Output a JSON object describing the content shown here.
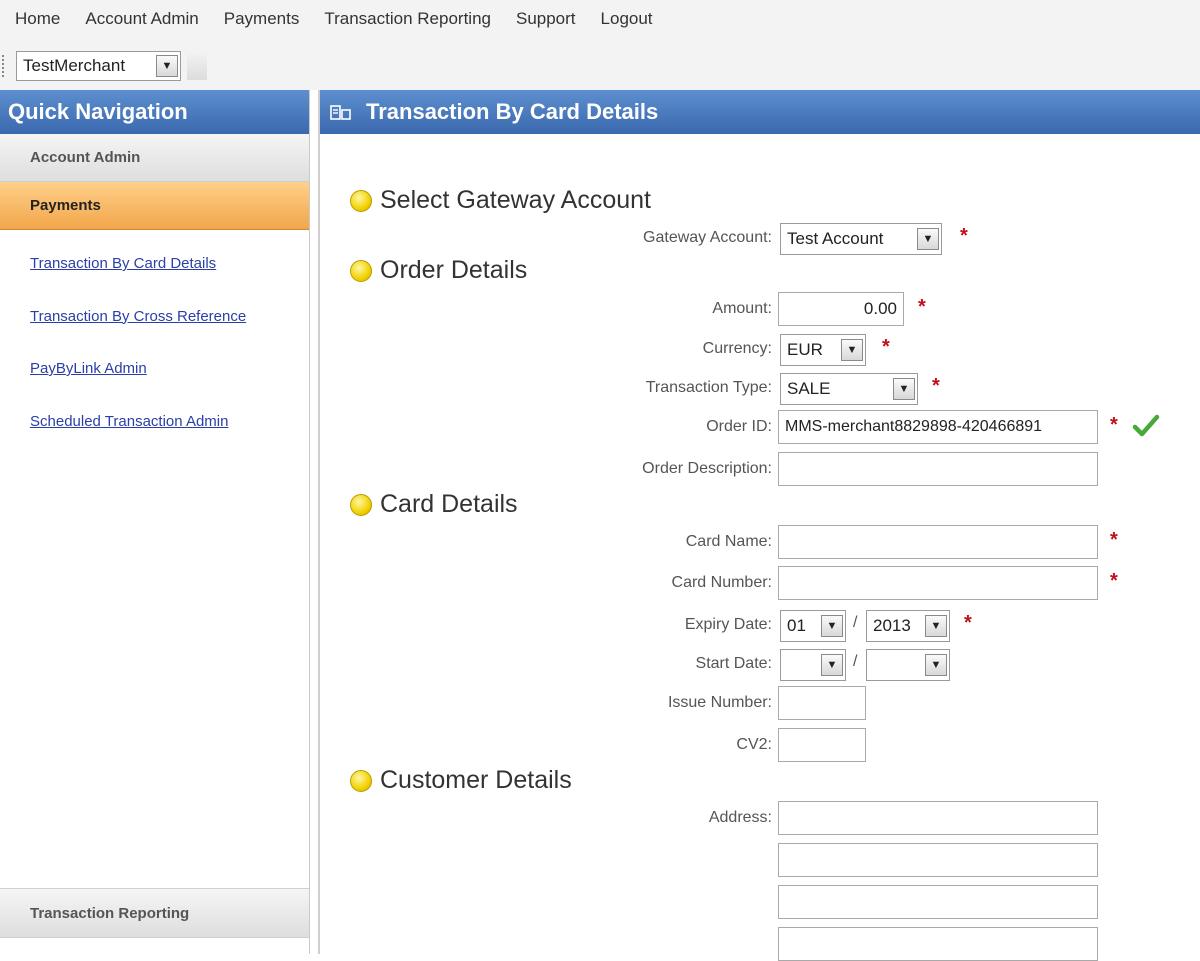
{
  "topmenu": [
    "Home",
    "Account Admin",
    "Payments",
    "Transaction Reporting",
    "Support",
    "Logout"
  ],
  "merchant": {
    "selected": "TestMerchant"
  },
  "sidebar": {
    "title": "Quick Navigation",
    "sections": {
      "account_admin": "Account Admin",
      "payments": "Payments",
      "transaction_reporting": "Transaction Reporting"
    },
    "links": [
      "Transaction By Card Details",
      "Transaction By Cross Reference",
      "PayByLink Admin",
      "Scheduled Transaction Admin"
    ]
  },
  "main": {
    "title": "Transaction By Card Details",
    "sections": {
      "gateway": "Select Gateway Account",
      "order": "Order Details",
      "card": "Card Details",
      "customer": "Customer Details"
    },
    "fields": {
      "gateway_account": {
        "label": "Gateway Account:",
        "value": "Test Account"
      },
      "amount": {
        "label": "Amount:",
        "value": "0.00"
      },
      "currency": {
        "label": "Currency:",
        "value": "EUR"
      },
      "transaction_type": {
        "label": "Transaction Type:",
        "value": "SALE"
      },
      "order_id": {
        "label": "Order ID:",
        "value": "MMS-merchant8829898-420466891"
      },
      "order_description": {
        "label": "Order Description:",
        "value": ""
      },
      "card_name": {
        "label": "Card Name:",
        "value": ""
      },
      "card_number": {
        "label": "Card Number:",
        "value": ""
      },
      "expiry_date": {
        "label": "Expiry Date:",
        "month": "01",
        "year": "2013",
        "separator": "/"
      },
      "start_date": {
        "label": "Start Date:",
        "month": "",
        "year": "",
        "separator": "/"
      },
      "issue_number": {
        "label": "Issue Number:",
        "value": ""
      },
      "cv2": {
        "label": "CV2:",
        "value": ""
      },
      "address": {
        "label": "Address:",
        "lines": [
          "",
          "",
          "",
          ""
        ]
      }
    },
    "required_marker": "*"
  },
  "colors": {
    "header_blue": "#3a69ad",
    "active_orange": "#f2a64a",
    "required_red": "#c0101b",
    "check_green": "#4aa83a",
    "link_blue": "#2a3fa8"
  },
  "icons": {
    "dropdown": "dropdown-arrow-icon",
    "bullet": "yellow-bullet-icon",
    "valid": "checkmark-icon",
    "page": "page-header-icon"
  }
}
